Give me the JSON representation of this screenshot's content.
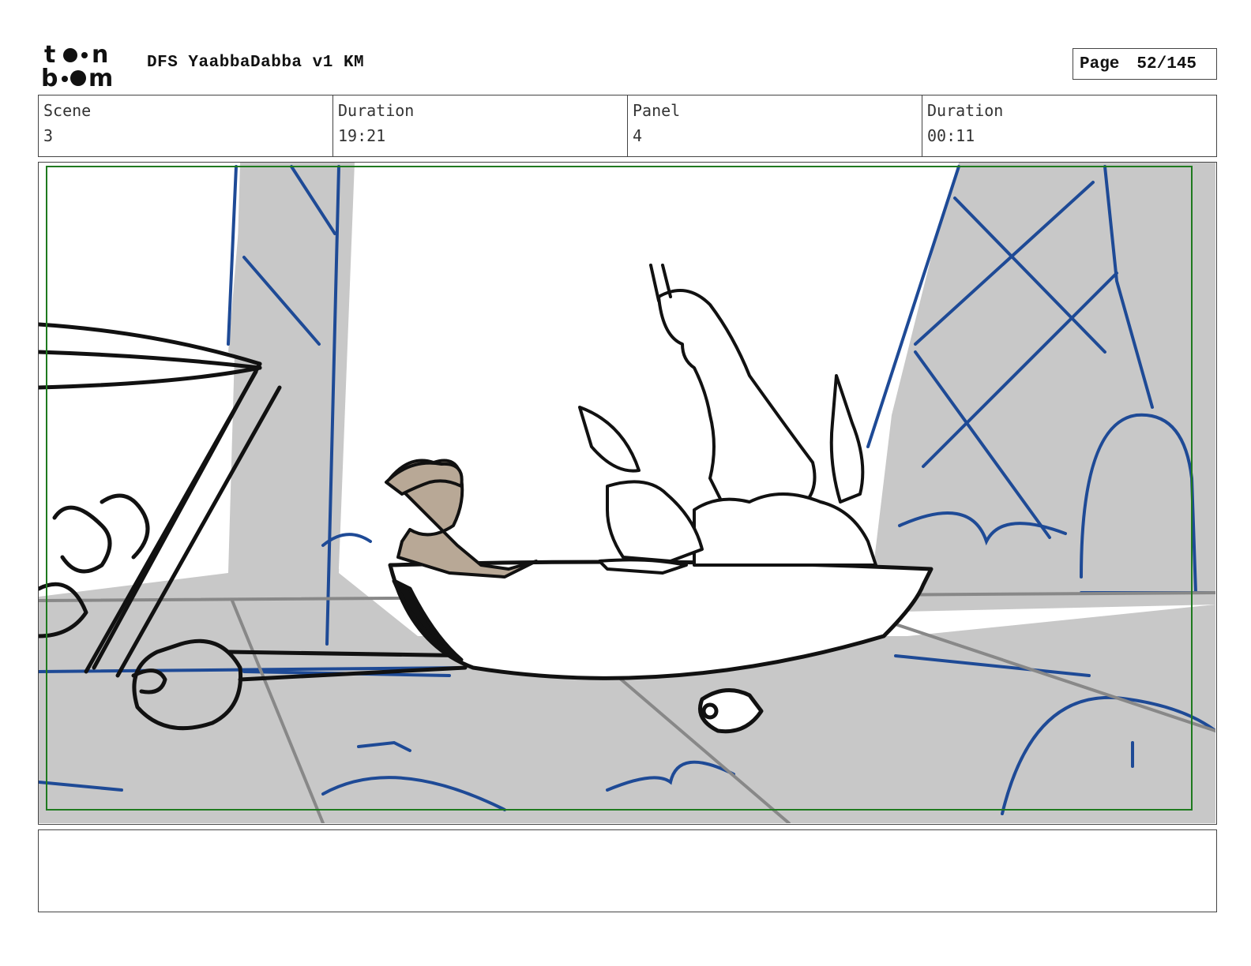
{
  "header": {
    "logo_text": "toonboom",
    "doc_title": "DFS YaabbaDabba v1 KM",
    "page_label": "Page",
    "page_value": "52/145"
  },
  "info": {
    "scene_label": "Scene",
    "scene_value": "3",
    "scene_duration_label": "Duration",
    "scene_duration_value": "19:21",
    "panel_label": "Panel",
    "panel_value": "4",
    "panel_duration_label": "Duration",
    "panel_duration_value": "00:11"
  },
  "panel": {
    "image_name": "storyboard-sketch",
    "colors": {
      "safe_frame": "#1f7a1f",
      "bg_gray": "#c8c8c8",
      "blue_line": "#1e4a96",
      "skin": "#b8a896",
      "ink": "#111111"
    }
  },
  "notes": {
    "text": ""
  }
}
